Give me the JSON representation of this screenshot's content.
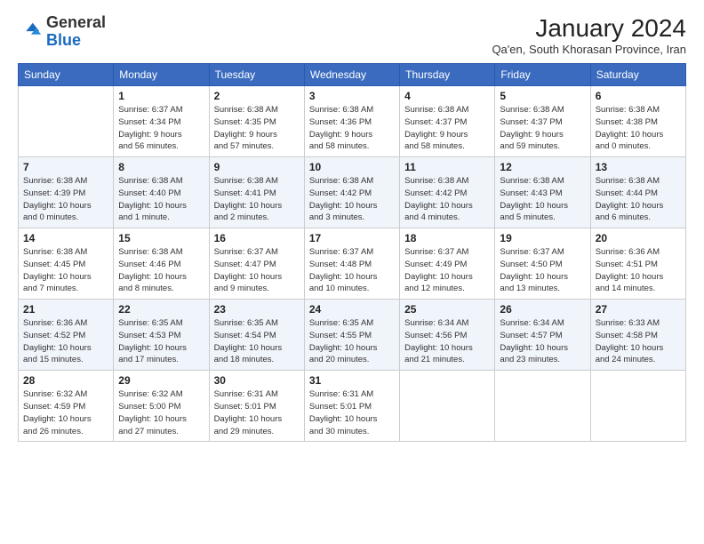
{
  "header": {
    "logo_general": "General",
    "logo_blue": "Blue",
    "month_title": "January 2024",
    "subtitle": "Qa'en, South Khorasan Province, Iran"
  },
  "weekdays": [
    "Sunday",
    "Monday",
    "Tuesday",
    "Wednesday",
    "Thursday",
    "Friday",
    "Saturday"
  ],
  "weeks": [
    [
      {
        "day": "",
        "info": ""
      },
      {
        "day": "1",
        "info": "Sunrise: 6:37 AM\nSunset: 4:34 PM\nDaylight: 9 hours\nand 56 minutes."
      },
      {
        "day": "2",
        "info": "Sunrise: 6:38 AM\nSunset: 4:35 PM\nDaylight: 9 hours\nand 57 minutes."
      },
      {
        "day": "3",
        "info": "Sunrise: 6:38 AM\nSunset: 4:36 PM\nDaylight: 9 hours\nand 58 minutes."
      },
      {
        "day": "4",
        "info": "Sunrise: 6:38 AM\nSunset: 4:37 PM\nDaylight: 9 hours\nand 58 minutes."
      },
      {
        "day": "5",
        "info": "Sunrise: 6:38 AM\nSunset: 4:37 PM\nDaylight: 9 hours\nand 59 minutes."
      },
      {
        "day": "6",
        "info": "Sunrise: 6:38 AM\nSunset: 4:38 PM\nDaylight: 10 hours\nand 0 minutes."
      }
    ],
    [
      {
        "day": "7",
        "info": "Sunrise: 6:38 AM\nSunset: 4:39 PM\nDaylight: 10 hours\nand 0 minutes."
      },
      {
        "day": "8",
        "info": "Sunrise: 6:38 AM\nSunset: 4:40 PM\nDaylight: 10 hours\nand 1 minute."
      },
      {
        "day": "9",
        "info": "Sunrise: 6:38 AM\nSunset: 4:41 PM\nDaylight: 10 hours\nand 2 minutes."
      },
      {
        "day": "10",
        "info": "Sunrise: 6:38 AM\nSunset: 4:42 PM\nDaylight: 10 hours\nand 3 minutes."
      },
      {
        "day": "11",
        "info": "Sunrise: 6:38 AM\nSunset: 4:42 PM\nDaylight: 10 hours\nand 4 minutes."
      },
      {
        "day": "12",
        "info": "Sunrise: 6:38 AM\nSunset: 4:43 PM\nDaylight: 10 hours\nand 5 minutes."
      },
      {
        "day": "13",
        "info": "Sunrise: 6:38 AM\nSunset: 4:44 PM\nDaylight: 10 hours\nand 6 minutes."
      }
    ],
    [
      {
        "day": "14",
        "info": "Sunrise: 6:38 AM\nSunset: 4:45 PM\nDaylight: 10 hours\nand 7 minutes."
      },
      {
        "day": "15",
        "info": "Sunrise: 6:38 AM\nSunset: 4:46 PM\nDaylight: 10 hours\nand 8 minutes."
      },
      {
        "day": "16",
        "info": "Sunrise: 6:37 AM\nSunset: 4:47 PM\nDaylight: 10 hours\nand 9 minutes."
      },
      {
        "day": "17",
        "info": "Sunrise: 6:37 AM\nSunset: 4:48 PM\nDaylight: 10 hours\nand 10 minutes."
      },
      {
        "day": "18",
        "info": "Sunrise: 6:37 AM\nSunset: 4:49 PM\nDaylight: 10 hours\nand 12 minutes."
      },
      {
        "day": "19",
        "info": "Sunrise: 6:37 AM\nSunset: 4:50 PM\nDaylight: 10 hours\nand 13 minutes."
      },
      {
        "day": "20",
        "info": "Sunrise: 6:36 AM\nSunset: 4:51 PM\nDaylight: 10 hours\nand 14 minutes."
      }
    ],
    [
      {
        "day": "21",
        "info": "Sunrise: 6:36 AM\nSunset: 4:52 PM\nDaylight: 10 hours\nand 15 minutes."
      },
      {
        "day": "22",
        "info": "Sunrise: 6:35 AM\nSunset: 4:53 PM\nDaylight: 10 hours\nand 17 minutes."
      },
      {
        "day": "23",
        "info": "Sunrise: 6:35 AM\nSunset: 4:54 PM\nDaylight: 10 hours\nand 18 minutes."
      },
      {
        "day": "24",
        "info": "Sunrise: 6:35 AM\nSunset: 4:55 PM\nDaylight: 10 hours\nand 20 minutes."
      },
      {
        "day": "25",
        "info": "Sunrise: 6:34 AM\nSunset: 4:56 PM\nDaylight: 10 hours\nand 21 minutes."
      },
      {
        "day": "26",
        "info": "Sunrise: 6:34 AM\nSunset: 4:57 PM\nDaylight: 10 hours\nand 23 minutes."
      },
      {
        "day": "27",
        "info": "Sunrise: 6:33 AM\nSunset: 4:58 PM\nDaylight: 10 hours\nand 24 minutes."
      }
    ],
    [
      {
        "day": "28",
        "info": "Sunrise: 6:32 AM\nSunset: 4:59 PM\nDaylight: 10 hours\nand 26 minutes."
      },
      {
        "day": "29",
        "info": "Sunrise: 6:32 AM\nSunset: 5:00 PM\nDaylight: 10 hours\nand 27 minutes."
      },
      {
        "day": "30",
        "info": "Sunrise: 6:31 AM\nSunset: 5:01 PM\nDaylight: 10 hours\nand 29 minutes."
      },
      {
        "day": "31",
        "info": "Sunrise: 6:31 AM\nSunset: 5:01 PM\nDaylight: 10 hours\nand 30 minutes."
      },
      {
        "day": "",
        "info": ""
      },
      {
        "day": "",
        "info": ""
      },
      {
        "day": "",
        "info": ""
      }
    ]
  ]
}
